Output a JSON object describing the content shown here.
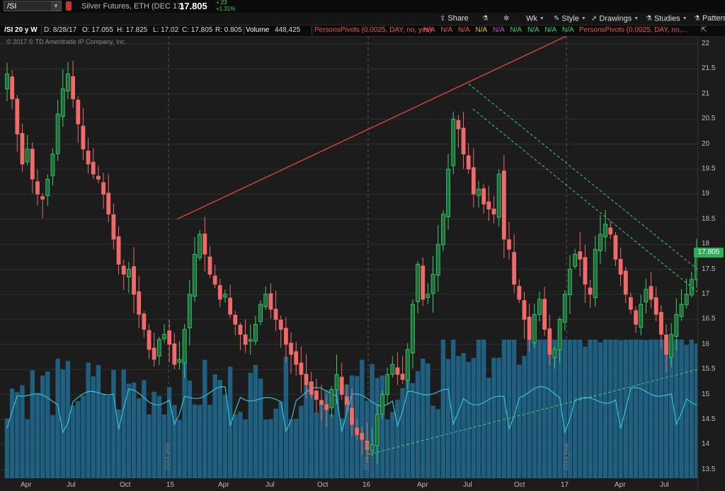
{
  "topbar": {
    "symbol": "/SI",
    "description": "Silver Futures, ETH (DEC 17)",
    "last": "17.805",
    "change_abs": "+.23",
    "change_pct": "+1.31%"
  },
  "toolbar": {
    "share": "Share",
    "period": "Wk",
    "style": "Style",
    "drawings": "Drawings",
    "studies": "Studies",
    "patterns": "Pattern"
  },
  "infobar": {
    "title": "/SI 20 y W",
    "date": "D: 8/28/17",
    "open": "O: 17.055",
    "high": "H: 17.825",
    "low": "L: 17.02",
    "close": "C: 17.805",
    "range": "R: 0.805",
    "volume_label": "Volume",
    "volume_value": "448,425",
    "study1": "PersonsPivots (0.0025, DAY, no, yes)",
    "na_values": [
      "N/A",
      "N/A",
      "N/A",
      "N/A",
      "N/A",
      "N/A",
      "N/A",
      "N/A",
      "N/A"
    ],
    "na_colors": [
      "#e85555",
      "#e85555",
      "#e85555",
      "#e0c040",
      "#c050d0",
      "#3bd16f",
      "#3bd16f",
      "#3bd16f",
      "#3bd16f"
    ],
    "study2": "PersonsPivots (0.0025, DAY, no,..."
  },
  "chart": {
    "copyright": "© 2017 © TD Ameritrade IP Company, Inc.",
    "price_ticks": [
      "22",
      "21.5",
      "21",
      "20.5",
      "20",
      "19.5",
      "19",
      "18.5",
      "18",
      "17.5",
      "17",
      "16.5",
      "16",
      "15.5",
      "15",
      "14.5",
      "14",
      "13.5"
    ],
    "x_ticks": [
      "Apr",
      "Jul",
      "Oct",
      "15",
      "Apr",
      "Jul",
      "Oct",
      "16",
      "Apr",
      "Jul",
      "Oct",
      "17",
      "Apr",
      "Jul"
    ],
    "year_labels": [
      "2014 year",
      "2016 year",
      "2016 year"
    ],
    "last_price_tag": "17.805",
    "colors": {
      "up": "#3bd16f",
      "down": "#f06a6a",
      "volume": "#1f5f80",
      "volume_line": "#34c0d8",
      "trend_red": "#d04040",
      "trend_green": "#3bd16f",
      "grid": "#2e2e2e"
    }
  },
  "chart_data": {
    "type": "candlestick",
    "timeframe": "weekly",
    "ylim": [
      13.4,
      22.1
    ],
    "closes": [
      21.4,
      20.9,
      20.2,
      19.6,
      19.9,
      19.3,
      19.0,
      18.9,
      19.3,
      19.8,
      20.6,
      21.1,
      21.4,
      20.9,
      20.4,
      19.9,
      19.6,
      19.4,
      19.3,
      19.0,
      18.6,
      18.1,
      17.6,
      17.4,
      17.5,
      17.0,
      16.6,
      16.3,
      15.9,
      15.7,
      16.1,
      16.2,
      16.0,
      15.6,
      15.7,
      16.3,
      17.0,
      17.8,
      18.2,
      17.8,
      17.4,
      17.2,
      16.9,
      17.0,
      16.6,
      16.4,
      16.2,
      16.0,
      16.1,
      16.4,
      16.8,
      17.0,
      16.7,
      16.5,
      16.3,
      16.0,
      15.8,
      15.6,
      15.4,
      15.2,
      15.0,
      14.9,
      14.8,
      14.7,
      15.1,
      15.4,
      15.0,
      14.8,
      14.4,
      14.2,
      14.1,
      13.9,
      14.0,
      14.6,
      15.0,
      15.4,
      15.6,
      15.4,
      15.3,
      15.9,
      16.8,
      17.6,
      16.9,
      17.0,
      17.4,
      18.0,
      18.6,
      19.5,
      20.5,
      20.3,
      19.8,
      19.5,
      19.0,
      19.1,
      18.8,
      18.7,
      18.6,
      19.4,
      18.1,
      17.9,
      17.2,
      16.9,
      16.5,
      16.1,
      16.6,
      16.9,
      16.3,
      15.8,
      15.9,
      16.5,
      17.0,
      17.5,
      17.8,
      17.7,
      17.2,
      17.0,
      17.9,
      18.2,
      18.4,
      18.2,
      17.7,
      17.4,
      17.0,
      16.7,
      16.4,
      16.8,
      17.1,
      16.9,
      16.6,
      16.2,
      15.8,
      16.2,
      16.6,
      16.8,
      17.0,
      17.3,
      17.805
    ],
    "trendlines": [
      {
        "color": "red",
        "from": [
          "Jan 2015",
          18.5
        ],
        "to": [
          "Aug 2017",
          22.3
        ]
      },
      {
        "color": "green-dashed",
        "from": [
          "Jul 2016",
          21.2
        ],
        "to": [
          "Aug 2017",
          17.6
        ]
      },
      {
        "color": "green-dashed",
        "from": [
          "Aug 2016",
          20.7
        ],
        "to": [
          "Aug 2017",
          17.1
        ]
      },
      {
        "color": "green-dashed",
        "from": [
          "Dec 2015",
          13.8
        ],
        "to": [
          "Aug 2017",
          15.5
        ]
      }
    ]
  }
}
